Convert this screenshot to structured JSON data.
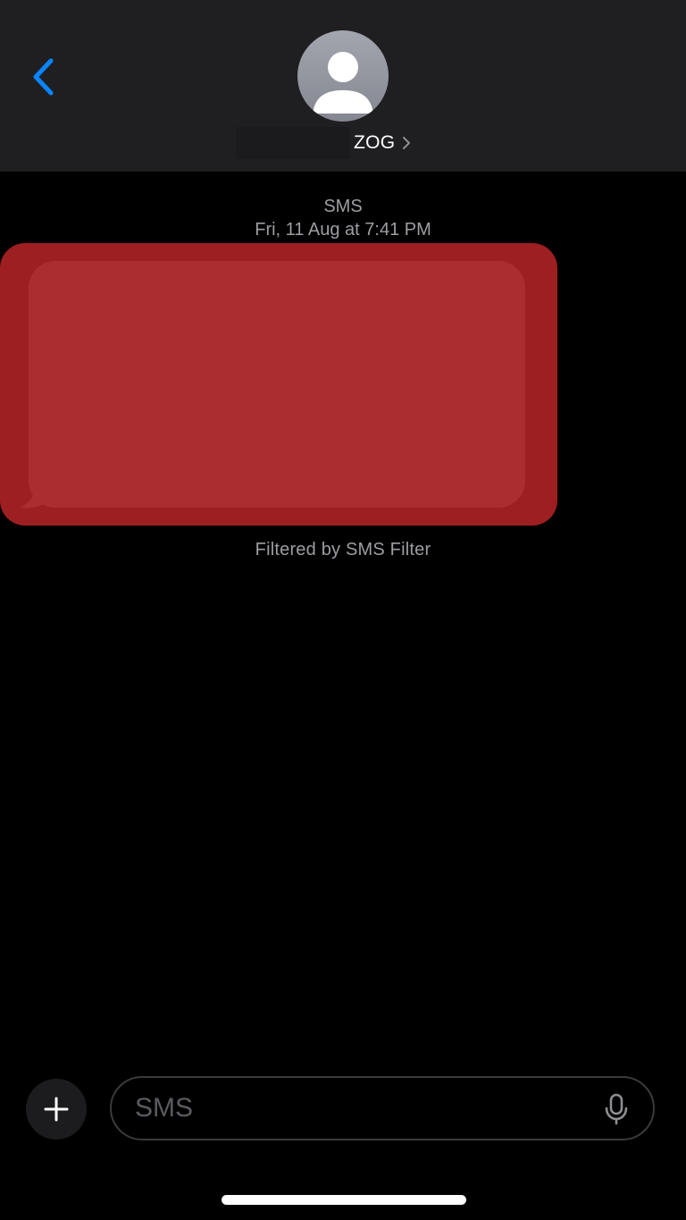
{
  "header": {
    "contact_name": "ZOG",
    "icons": {
      "back": "chevron-left-icon",
      "avatar": "person-silhouette-icon",
      "details": "chevron-right-icon"
    }
  },
  "conversation": {
    "service_label": "SMS",
    "timestamp": "Fri, 11 Aug at 7:41 PM",
    "filter_note": "Filtered by SMS Filter",
    "message": {
      "text": "",
      "redacted": true
    }
  },
  "composer": {
    "placeholder": "SMS",
    "value": "",
    "icons": {
      "add": "plus-icon",
      "dictation": "microphone-icon"
    }
  },
  "colors": {
    "accent": "#0a84ff",
    "header_bg": "#1f1f21",
    "background": "#000000",
    "secondary_text": "#9d9da3",
    "redaction": "#9e1f21"
  }
}
